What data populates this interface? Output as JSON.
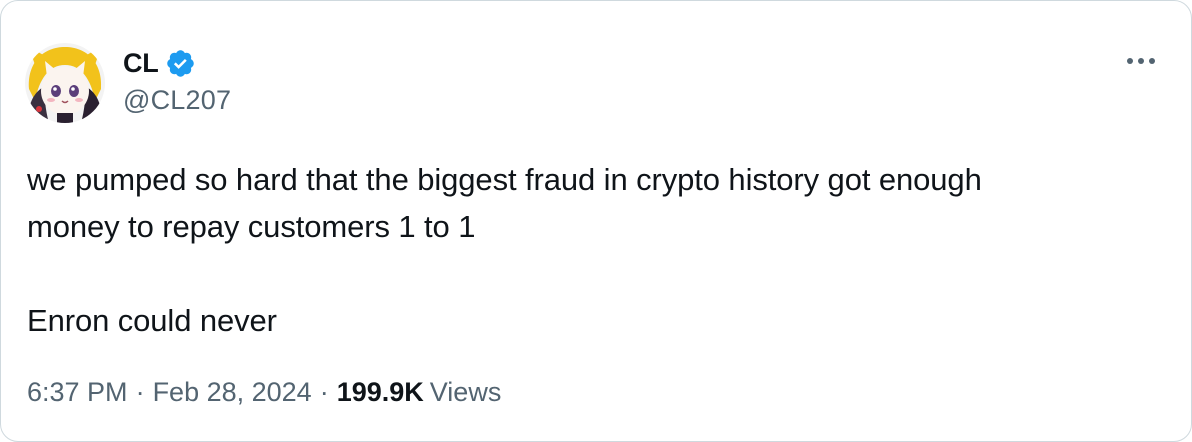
{
  "author": {
    "display_name": "CL",
    "handle": "@CL207",
    "verified": true,
    "verified_color": "#1d9bf0"
  },
  "tweet": {
    "lines": [
      "we pumped so hard that the biggest fraud in crypto history got enough",
      "money to repay customers 1 to 1"
    ],
    "second_paragraph": "Enron could never"
  },
  "meta": {
    "time": "6:37 PM",
    "separator": "·",
    "date": "Feb 28, 2024",
    "views_count": "199.9K",
    "views_label": "Views"
  },
  "icons": {
    "more": "more-horizontal-icon",
    "verified": "verified-badge-icon"
  },
  "colors": {
    "text_primary": "#0f1419",
    "text_secondary": "#536471",
    "border": "#cfd9de",
    "accent": "#1d9bf0"
  }
}
